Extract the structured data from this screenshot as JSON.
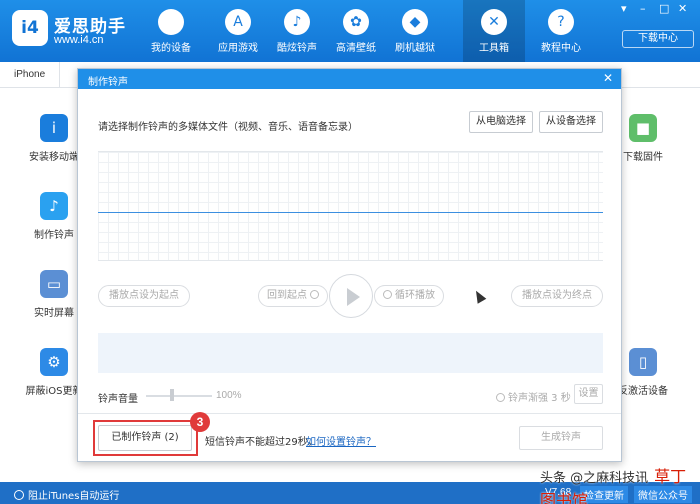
{
  "app": {
    "brand": "爱思助手",
    "url": "www.i4.cn",
    "logo_text": "i4"
  },
  "nav": [
    {
      "label": "我的设备",
      "icon": "apple-icon",
      "glyph": ""
    },
    {
      "label": "应用游戏",
      "icon": "app-store-icon",
      "glyph": "A"
    },
    {
      "label": "酷炫铃声",
      "icon": "bell-icon",
      "glyph": "♪"
    },
    {
      "label": "高清壁纸",
      "icon": "flower-icon",
      "glyph": "✿"
    },
    {
      "label": "刷机越狱",
      "icon": "dropbox-icon",
      "glyph": "◆"
    },
    {
      "label": "工具箱",
      "icon": "tools-icon",
      "glyph": "✕"
    },
    {
      "label": "教程中心",
      "icon": "tutorial-icon",
      "glyph": "?"
    }
  ],
  "window_controls": [
    "▾",
    "–",
    "□",
    "✕"
  ],
  "download_center": "下载中心",
  "tab": "iPhone",
  "tools_left": [
    {
      "label": "安装移动端",
      "icon": "i4-app-icon",
      "color": "#1a7ddc",
      "glyph": "i"
    },
    {
      "label": "制作铃声",
      "icon": "bell-icon",
      "color": "#2aa1f0",
      "glyph": "♪"
    },
    {
      "label": "实时屏幕",
      "icon": "monitor-icon",
      "color": "#5b8fd4",
      "glyph": "▭"
    },
    {
      "label": "屏蔽iOS更新",
      "icon": "gear-icon",
      "color": "#2d8ae6",
      "glyph": "⚙"
    }
  ],
  "tools_right": [
    {
      "label": "下载固件",
      "icon": "cube-icon",
      "color": "#5fbe6a",
      "glyph": "■"
    },
    {
      "label": "反激活设备",
      "icon": "tablet-icon",
      "color": "#5b8fd4",
      "glyph": "▯"
    }
  ],
  "modal": {
    "title": "制作铃声",
    "prompt": "请选择制作铃声的多媒体文件（视频、音乐、语音备忘录）",
    "from_pc": "从电脑选择",
    "from_device": "从设备选择",
    "set_start": "播放点设为起点",
    "back_to_start": "回到起点",
    "loop_play": "循环播放",
    "set_end": "播放点设为终点",
    "volume_label": "铃声音量",
    "volume_pct": "100%",
    "volume_level": 0.4,
    "fade_label": "铃声渐强 3 秒",
    "settings": "设置",
    "made_ringtones": "已制作铃声 (2)",
    "note": "短信铃声不能超过29秒。",
    "help_link": "如何设置铃声？",
    "generate": "生成铃声",
    "step_badge": "3"
  },
  "status": {
    "block_itunes": "阻止iTunes自动运行",
    "version": "V7.68",
    "check_update": "检查更新",
    "wechat": "微信公众号"
  },
  "watermark": {
    "left": "头条 @之麻科技讯",
    "right": "草丁图书馆"
  }
}
